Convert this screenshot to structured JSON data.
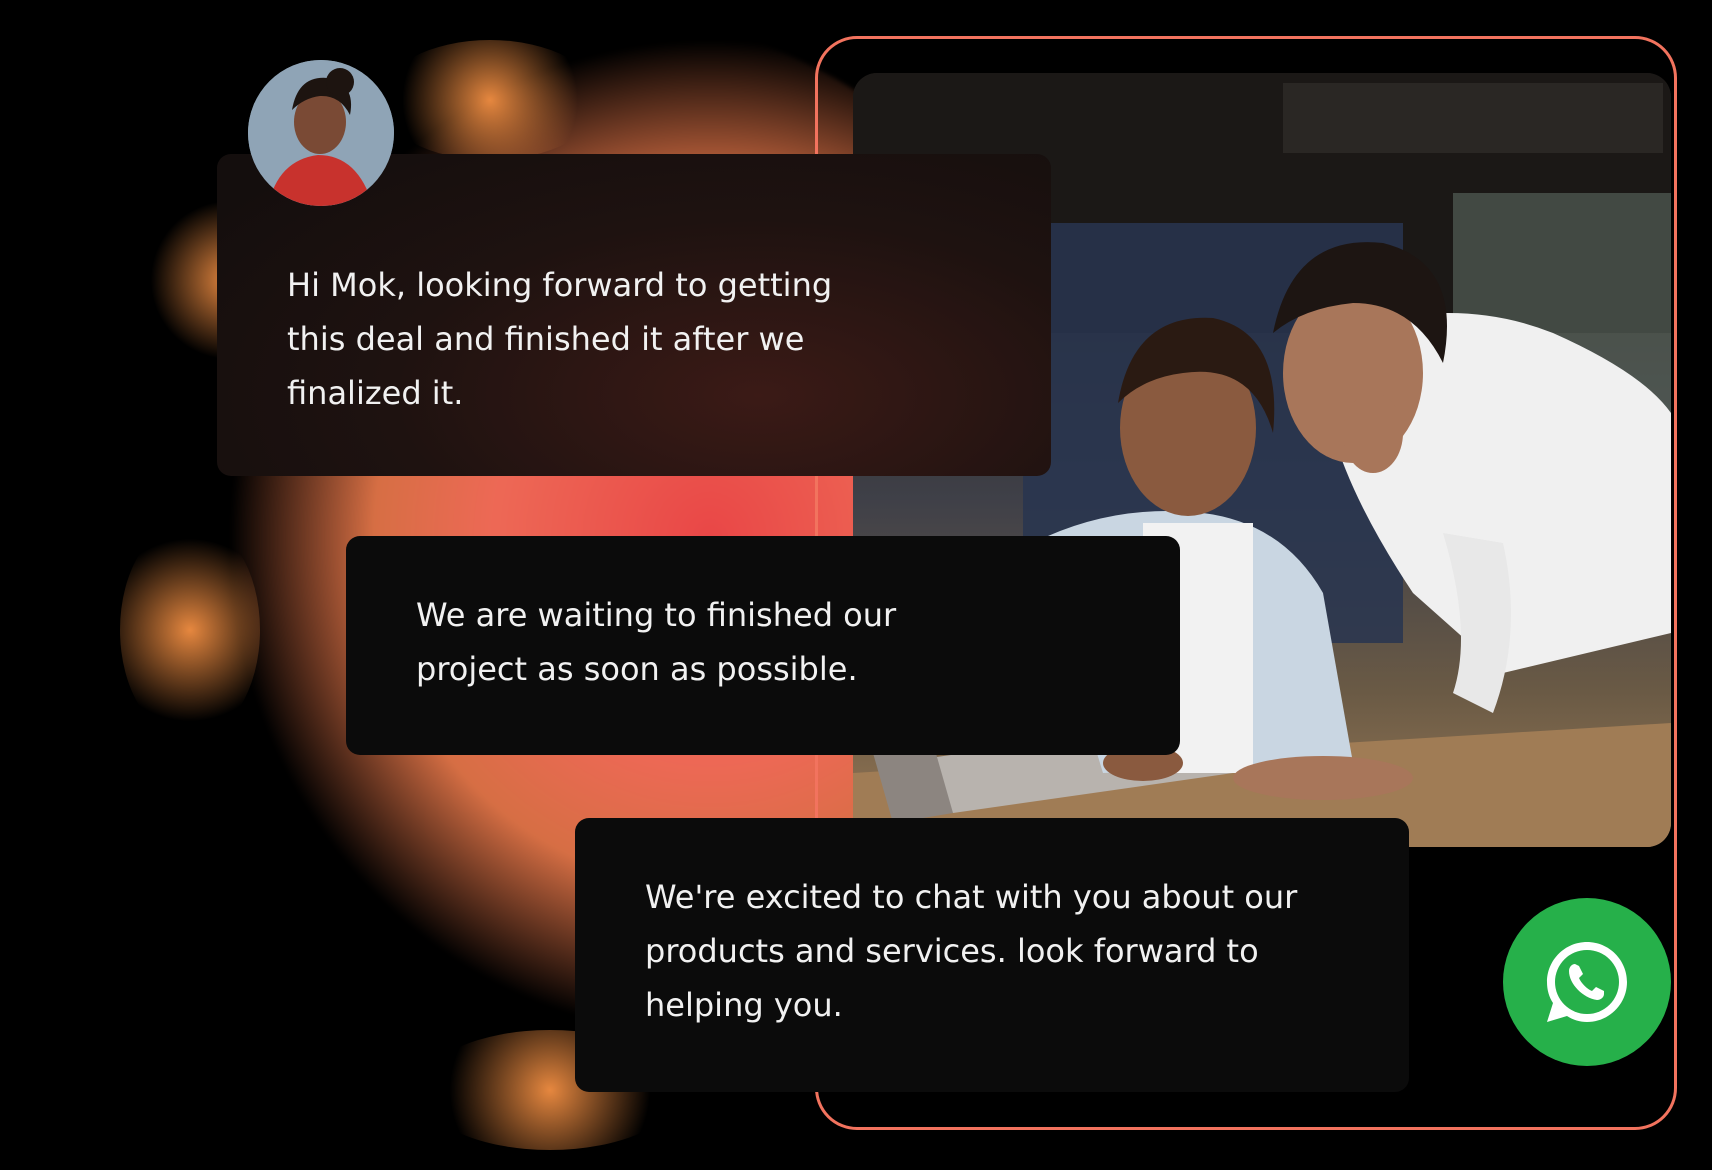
{
  "chat": {
    "messages": [
      {
        "text": "Hi Mok, looking forward to getting this deal and finished it after we finalized it."
      },
      {
        "text": "We are waiting to finished our project as soon as possible."
      },
      {
        "text": "We're excited to chat with you about our products and services. look forward to helping you."
      }
    ]
  },
  "icons": {
    "avatar": "user-avatar",
    "chat_button": "whatsapp-icon"
  },
  "colors": {
    "accent": "#f2735e",
    "splash": "#f25a4e",
    "bubble": "#0b0b0b",
    "whatsapp": "#26b04a"
  }
}
